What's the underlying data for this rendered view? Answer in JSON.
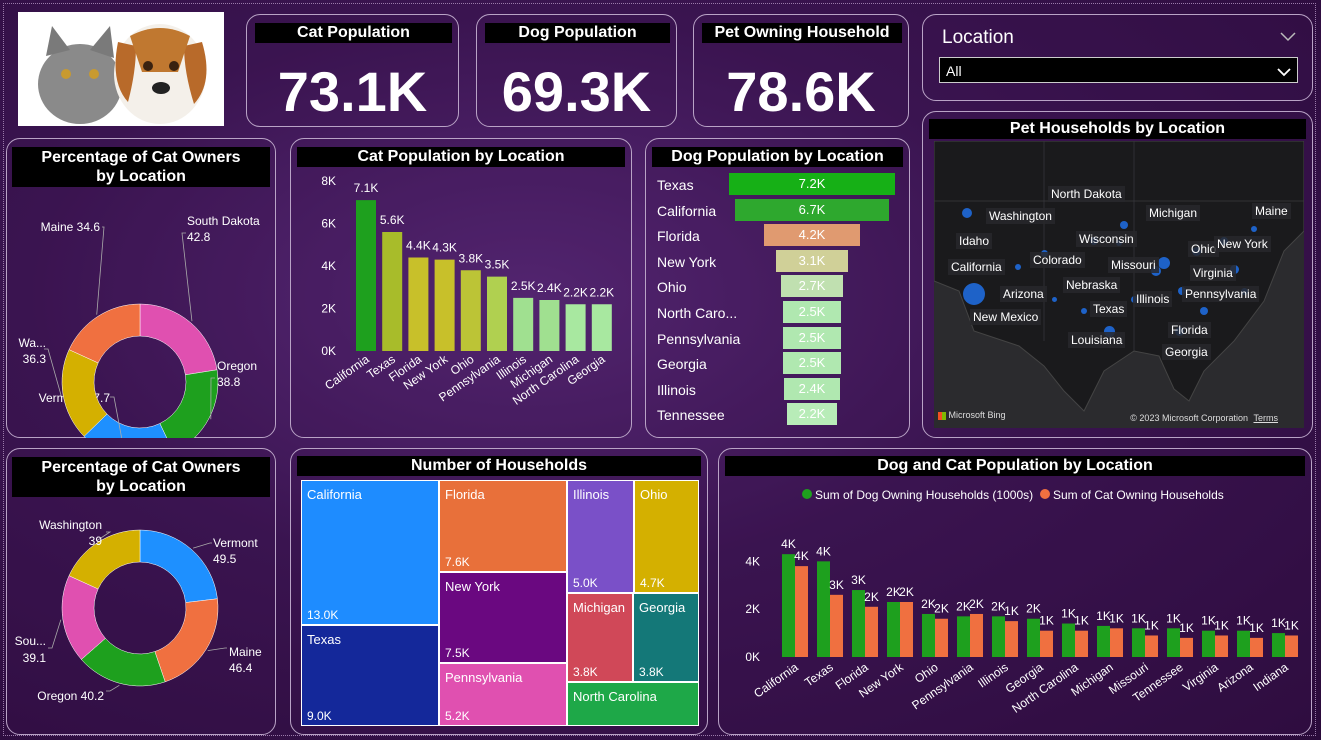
{
  "kpis": {
    "cat": {
      "label": "Cat Population",
      "value": "73.1K"
    },
    "dog": {
      "label": "Dog Population",
      "value": "69.3K"
    },
    "households": {
      "label": "Pet Owning Household",
      "value": "78.6K"
    }
  },
  "filter": {
    "title": "Location",
    "selected": "All"
  },
  "donut1": {
    "title": [
      "Percentage of Cat Owners",
      "by Location"
    ],
    "slices": [
      {
        "name": "South Dakota",
        "value": 42.8,
        "color": "#e050b0",
        "label": "South Dakota",
        "value_label": "42.8"
      },
      {
        "name": "Oregon",
        "value": 38.8,
        "color": "#1ea01e",
        "label": "Oregon",
        "value_label": "38.8"
      },
      {
        "name": "Vermont",
        "value": 37.7,
        "color": "#1e90ff",
        "label": "Vermont 37.7",
        "value_label": ""
      },
      {
        "name": "Washington",
        "value": 36.3,
        "color": "#d4b000",
        "label": "Wa...",
        "value_label": "36.3"
      },
      {
        "name": "Maine",
        "value": 34.6,
        "color": "#f07040",
        "label": "Maine 34.6",
        "value_label": ""
      }
    ]
  },
  "donut2": {
    "title": [
      "Percentage of Cat Owners",
      "by Location"
    ],
    "slices": [
      {
        "name": "Vermont",
        "value": 49.5,
        "color": "#1e90ff",
        "label": "Vermont",
        "value_label": "49.5"
      },
      {
        "name": "Maine",
        "value": 46.4,
        "color": "#f07040",
        "label": "Maine",
        "value_label": "46.4"
      },
      {
        "name": "Oregon",
        "value": 40.2,
        "color": "#1ea01e",
        "label": "Oregon 40.2",
        "value_label": ""
      },
      {
        "name": "South Dakota",
        "value": 39.1,
        "color": "#e050b0",
        "label": "Sou...",
        "value_label": "39.1"
      },
      {
        "name": "Washington",
        "value": 39.0,
        "color": "#d4b000",
        "label": "Washington",
        "value_label": "39"
      }
    ]
  },
  "chart_data": [
    {
      "id": "cat_by_location",
      "type": "bar",
      "title": "Cat Population by Location",
      "categories": [
        "California",
        "Texas",
        "Florida",
        "New York",
        "Ohio",
        "Pennsylvania",
        "Illinois",
        "Michigan",
        "North Carolina",
        "Georgia"
      ],
      "values": [
        7.1,
        5.6,
        4.4,
        4.3,
        3.8,
        3.5,
        2.5,
        2.4,
        2.2,
        2.2
      ],
      "value_labels": [
        "7.1K",
        "5.6K",
        "4.4K",
        "4.3K",
        "3.8K",
        "3.5K",
        "2.5K",
        "2.4K",
        "2.2K",
        "2.2K"
      ],
      "colors": [
        "#1ea01e",
        "#a8bc2a",
        "#c8c02a",
        "#c8c02a",
        "#bcc436",
        "#b0d050",
        "#a0e090",
        "#a0e090",
        "#a8e8a0",
        "#a8e8a0"
      ],
      "yticks": [
        "0K",
        "2K",
        "4K",
        "6K",
        "8K"
      ],
      "ylim": [
        0,
        8
      ]
    },
    {
      "id": "dog_by_location",
      "type": "bar",
      "title": "Dog Population by Location",
      "categories": [
        "Texas",
        "California",
        "Florida",
        "New York",
        "Ohio",
        "North Caro...",
        "Pennsylvania",
        "Georgia",
        "Illinois",
        "Tennessee"
      ],
      "values": [
        7.2,
        6.7,
        4.2,
        3.1,
        2.7,
        2.5,
        2.5,
        2.5,
        2.4,
        2.2
      ],
      "value_labels": [
        "7.2K",
        "6.7K",
        "4.2K",
        "3.1K",
        "2.7K",
        "2.5K",
        "2.5K",
        "2.5K",
        "2.4K",
        "2.2K"
      ],
      "colors": [
        "#16b016",
        "#2ea82e",
        "#e09a70",
        "#d0d098",
        "#c0e0b0",
        "#b0e8b0",
        "#b0e8b0",
        "#b0e8b0",
        "#b0e8b0",
        "#b8ecb8"
      ]
    },
    {
      "id": "households_treemap",
      "type": "treemap",
      "title": "Number of Households",
      "items": [
        {
          "name": "California",
          "value": "13.0K",
          "color": "#1e8cff"
        },
        {
          "name": "Texas",
          "value": "9.0K",
          "color": "#14289a"
        },
        {
          "name": "Florida",
          "value": "7.6K",
          "color": "#e8703a"
        },
        {
          "name": "New York",
          "value": "7.5K",
          "color": "#6a0880"
        },
        {
          "name": "Pennsylvania",
          "value": "5.2K",
          "color": "#e050b0"
        },
        {
          "name": "Illinois",
          "value": "5.0K",
          "color": "#7a50c8"
        },
        {
          "name": "Ohio",
          "value": "4.7K",
          "color": "#d4b000"
        },
        {
          "name": "Michigan",
          "value": "3.8K",
          "color": "#d04858"
        },
        {
          "name": "Georgia",
          "value": "3.8K",
          "color": "#147878"
        },
        {
          "name": "North Carolina",
          "value": "",
          "color": "#1ea848"
        }
      ]
    },
    {
      "id": "dog_cat_by_location",
      "type": "bar",
      "title": "Dog and Cat Population by Location",
      "categories": [
        "California",
        "Texas",
        "Florida",
        "New York",
        "Ohio",
        "Pennsylvania",
        "Illinois",
        "Georgia",
        "North Carolina",
        "Michigan",
        "Missouri",
        "Tennessee",
        "Virginia",
        "Arizona",
        "Indiana"
      ],
      "series": [
        {
          "name": "Sum of Dog Owning Households (1000s)",
          "color": "#1ea01e",
          "values": [
            4.3,
            4.0,
            2.8,
            2.3,
            1.8,
            1.7,
            1.7,
            1.6,
            1.4,
            1.3,
            1.2,
            1.2,
            1.1,
            1.1,
            1.0
          ],
          "labels": [
            "4K",
            "4K",
            "3K",
            "2K",
            "2K",
            "2K",
            "2K",
            "2K",
            "1K",
            "1K",
            "1K",
            "1K",
            "1K",
            "1K",
            "1K"
          ]
        },
        {
          "name": "Sum of Cat Owning Households",
          "color": "#f07040",
          "values": [
            3.8,
            2.6,
            2.1,
            2.3,
            1.6,
            1.8,
            1.5,
            1.1,
            1.1,
            1.2,
            0.9,
            0.8,
            0.9,
            0.8,
            0.9
          ],
          "labels": [
            "4K",
            "3K",
            "2K",
            "2K",
            "2K",
            "2K",
            "1K",
            "1K",
            "1K",
            "1K",
            "1K",
            "1K",
            "1K",
            "1K",
            "1K"
          ]
        }
      ],
      "yticks": [
        "0K",
        "2K",
        "4K"
      ],
      "ylim": [
        0,
        4.6
      ]
    }
  ],
  "map": {
    "title": "Pet Households by Location",
    "labels": [
      "North Dakota",
      "Washington",
      "Michigan",
      "Maine",
      "Idaho",
      "Wisconsin",
      "Ohio",
      "New York",
      "California",
      "Colorado",
      "Missouri",
      "Virginia",
      "Nebraska",
      "Arizona",
      "Illinois",
      "Pennsylvania",
      "Texas",
      "New Mexico",
      "Florida",
      "Louisiana",
      "Georgia"
    ],
    "attribution_brand": "Microsoft Bing",
    "copyright": "© 2023 Microsoft Corporation",
    "terms": "Terms"
  }
}
